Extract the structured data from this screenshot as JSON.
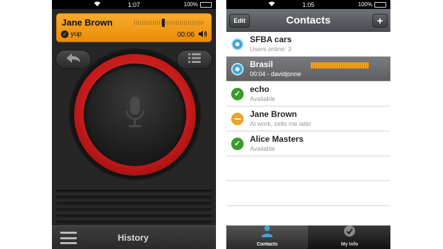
{
  "left_screen": {
    "statusbar": {
      "time": "1:07",
      "battery": "100%"
    },
    "call_card": {
      "name": "Jane Brown",
      "status": "yup",
      "time": "00:06"
    },
    "bottom_bar": {
      "title": "History"
    }
  },
  "right_screen": {
    "statusbar": {
      "time": "1:05",
      "battery": "100%"
    },
    "navbar": {
      "edit_label": "Edit",
      "title": "Contacts",
      "add_label": "+"
    },
    "contacts": [
      {
        "name": "SFBA cars",
        "subtitle": "Users online: 3",
        "status": "group"
      },
      {
        "name": "Brasil",
        "subtitle": "00:04 - davidjonne",
        "status": "group",
        "active": true
      },
      {
        "name": "echo",
        "subtitle": "Available",
        "status": "available"
      },
      {
        "name": "Jane Brown",
        "subtitle": "At work, zello me later",
        "status": "busy"
      },
      {
        "name": "Alice Masters",
        "subtitle": "Available",
        "status": "available"
      }
    ],
    "tabs": [
      {
        "label": "Contacts",
        "icon": "person-icon",
        "selected": true
      },
      {
        "label": "My Info",
        "icon": "check-circle-icon",
        "selected": false
      }
    ]
  },
  "colors": {
    "accent_orange": "#f3a21b",
    "ptt_red": "#d42020",
    "available_green": "#3a9b2a",
    "group_blue": "#3aa6d6"
  }
}
